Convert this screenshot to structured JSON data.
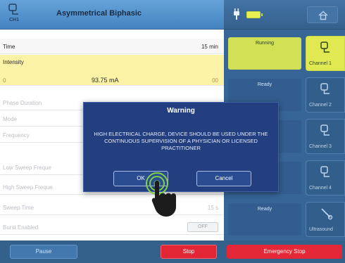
{
  "header": {
    "channel_label": "CH1",
    "program_title": "Asymmetrical Biphasic"
  },
  "params": {
    "time": {
      "label": "Time",
      "value": "15 min"
    },
    "intensity": {
      "label": "Intensity",
      "min": "0",
      "value": "93.75 mA",
      "max": "00"
    },
    "phase_duration": {
      "label": "Phase Duration"
    },
    "mode": {
      "label": "Mode"
    },
    "frequency": {
      "label": "Frequency"
    },
    "low_sweep": {
      "label": "Low Sweep Freque"
    },
    "high_sweep": {
      "label": "High Sweep Freque"
    },
    "sweep_time": {
      "label": "Sweep Time",
      "value": "15 s"
    },
    "burst": {
      "label": "Burst Enabled",
      "value": "OFF"
    }
  },
  "footer": {
    "pause": "Pause",
    "stop": "Stop",
    "emergency_stop": "Emergency Stop"
  },
  "channels": [
    {
      "status": "Running",
      "label": "Channel 1",
      "active": true
    },
    {
      "status": "Ready",
      "label": "Channel 2",
      "active": false
    },
    {
      "status": "",
      "label": "Channel 3",
      "active": false
    },
    {
      "status": "",
      "label": "Channel 4",
      "active": false
    },
    {
      "status": "Ready",
      "label": "Ultrasound",
      "active": false
    }
  ],
  "dialog": {
    "title": "Warning",
    "message": "HIGH ELECTRICAL CHARGE, DEVICE SHOULD BE USED UNDER THE CONTINUOUS SUPERVISION OF A PHYSICIAN OR LICENSED PRACTITIONER",
    "ok": "OK",
    "cancel": "Cancel"
  },
  "colors": {
    "header_blue": "#4a8cc9",
    "intensity_highlight": "#fdf3a3",
    "active_channel": "#dfe94a",
    "stop_red": "#e21e2e",
    "dialog_blue": "#233f80"
  },
  "icons": {
    "channel": "electrode-pad-icon",
    "plug": "power-plug-icon",
    "battery": "battery-icon",
    "home": "home-icon",
    "ultrasound": "ultrasound-probe-icon",
    "cursor": "hand-pointer-icon"
  }
}
